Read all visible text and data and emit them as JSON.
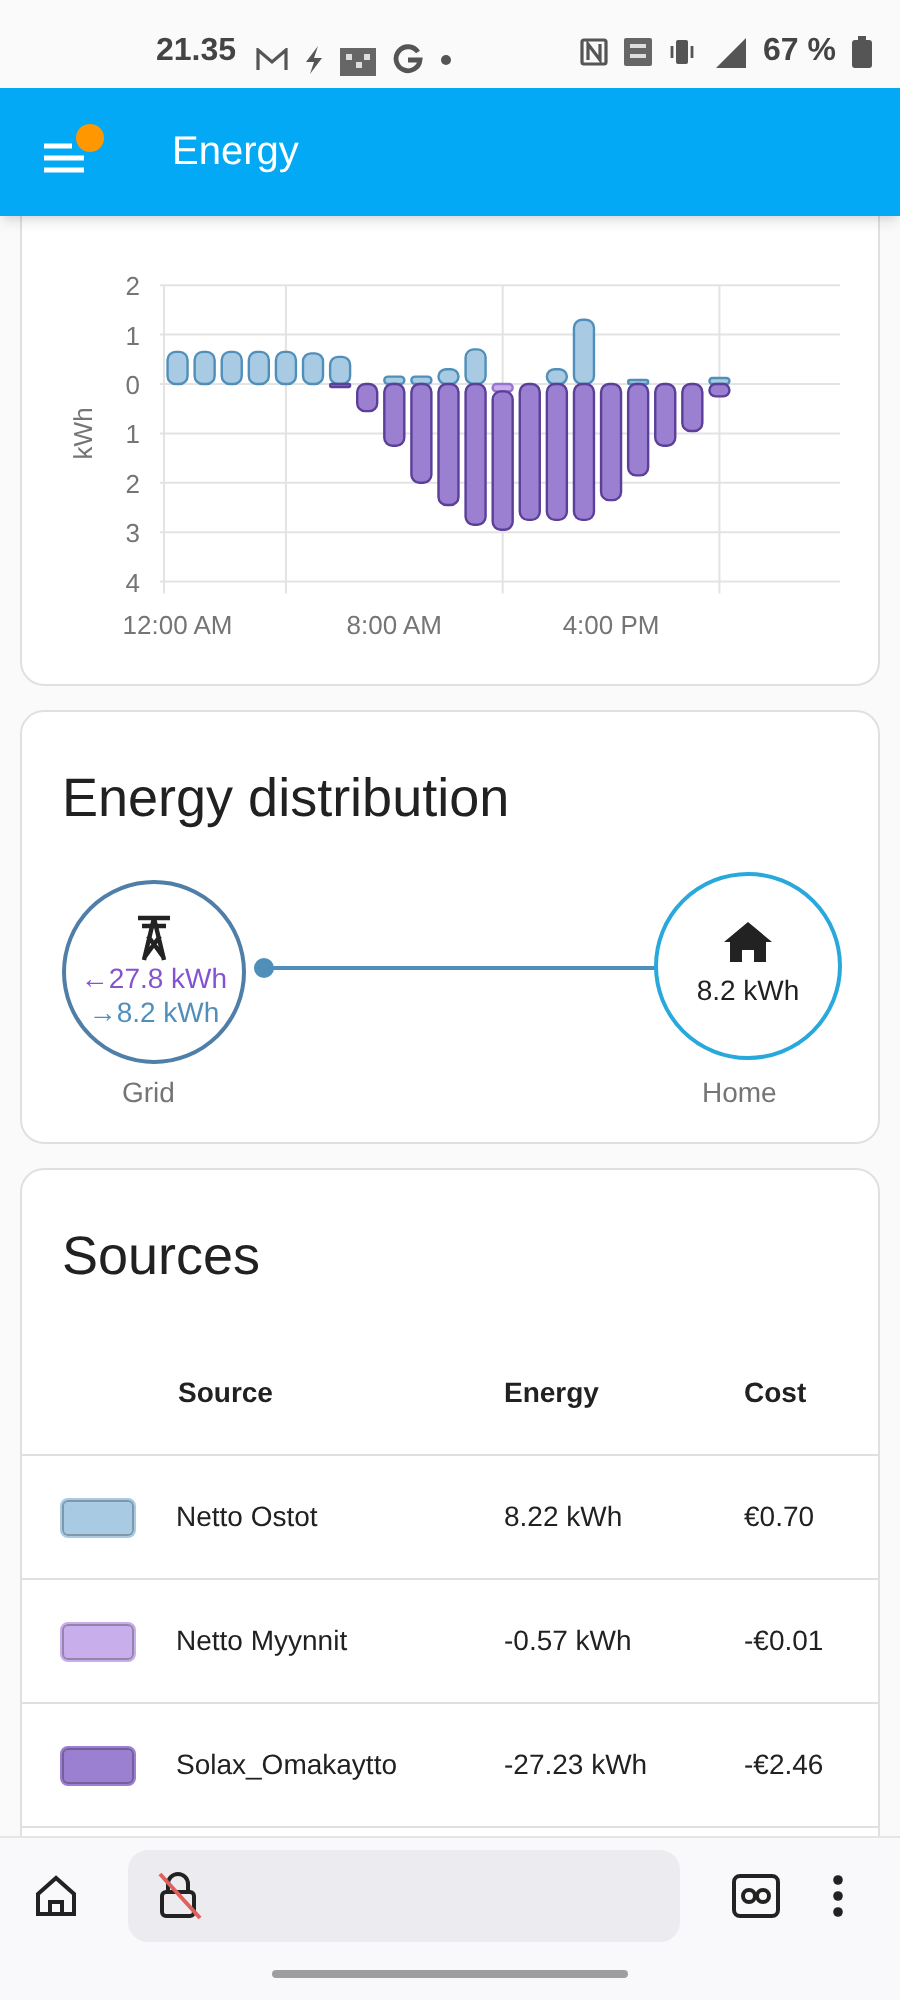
{
  "status_bar": {
    "time": "21.35",
    "battery": "67 %"
  },
  "app_bar": {
    "title": "Energy",
    "notification": true
  },
  "usage_card": {
    "chart_data": {
      "type": "bar",
      "stacked": true,
      "grid": true,
      "xlim": [
        -0.5,
        24.45
      ],
      "ylabel": "kWh",
      "x": [
        0,
        1,
        2,
        3,
        4,
        5,
        6,
        7,
        8,
        9,
        10,
        11,
        12,
        13,
        14,
        15,
        16,
        17,
        18,
        19,
        20
      ],
      "xticks": [
        {
          "value": 0,
          "label": "12:00 AM"
        },
        {
          "value": 8,
          "label": "8:00 AM"
        },
        {
          "value": 16,
          "label": "4:00 PM"
        }
      ],
      "ylim": [
        -4,
        2
      ],
      "yticks": [
        {
          "value": 2,
          "label": "2"
        },
        {
          "value": 1,
          "label": "1"
        },
        {
          "value": 0,
          "label": "0"
        },
        {
          "value": -1,
          "label": "1"
        },
        {
          "value": -2,
          "label": "2"
        },
        {
          "value": -3,
          "label": "3"
        },
        {
          "value": -4,
          "label": "4"
        }
      ],
      "series": [
        {
          "color": "#a8cbe3",
          "values": [
            0.65,
            0.65,
            0.65,
            0.65,
            0.65,
            0.62,
            0.55,
            0,
            0.15,
            0.15,
            0.3,
            0.7,
            0,
            0,
            0.3,
            1.3,
            0,
            0.08,
            0,
            0,
            0.12
          ]
        },
        {
          "color": "#c8aeea",
          "values": [
            0,
            0,
            0,
            0,
            0,
            0,
            0,
            0,
            0,
            0,
            0,
            0,
            -0.15,
            0,
            0,
            0,
            0,
            0,
            0,
            0,
            0
          ]
        },
        {
          "color": "#9b7fd0",
          "values": [
            0,
            0,
            0,
            0,
            0,
            0,
            -0.05,
            -0.55,
            -1.25,
            -2.0,
            -2.45,
            -2.85,
            -2.8,
            -2.75,
            -2.75,
            -2.75,
            -2.35,
            -1.85,
            -1.25,
            -0.95,
            -0.25
          ]
        }
      ]
    }
  },
  "distribution": {
    "title": "Energy distribution",
    "grid": {
      "label": "Grid",
      "returned": "←27.8 kWh",
      "consumed": "→8.2 kWh"
    },
    "home": {
      "label": "Home",
      "value": "8.2 kWh"
    }
  },
  "sources": {
    "title": "Sources",
    "columns": [
      "Source",
      "Energy",
      "Cost"
    ],
    "rows": [
      {
        "color": "#a8cbe3",
        "name": "Netto Ostot",
        "energy": "8.22 kWh",
        "cost": "€0.70"
      },
      {
        "color": "#c8aeea",
        "name": "Netto Myynnit",
        "energy": "-0.57 kWh",
        "cost": "-€0.01"
      },
      {
        "color": "#9b7fd0",
        "name": "Solax_Omakaytto",
        "energy": "-27.23 kWh",
        "cost": "-€2.46"
      }
    ]
  }
}
